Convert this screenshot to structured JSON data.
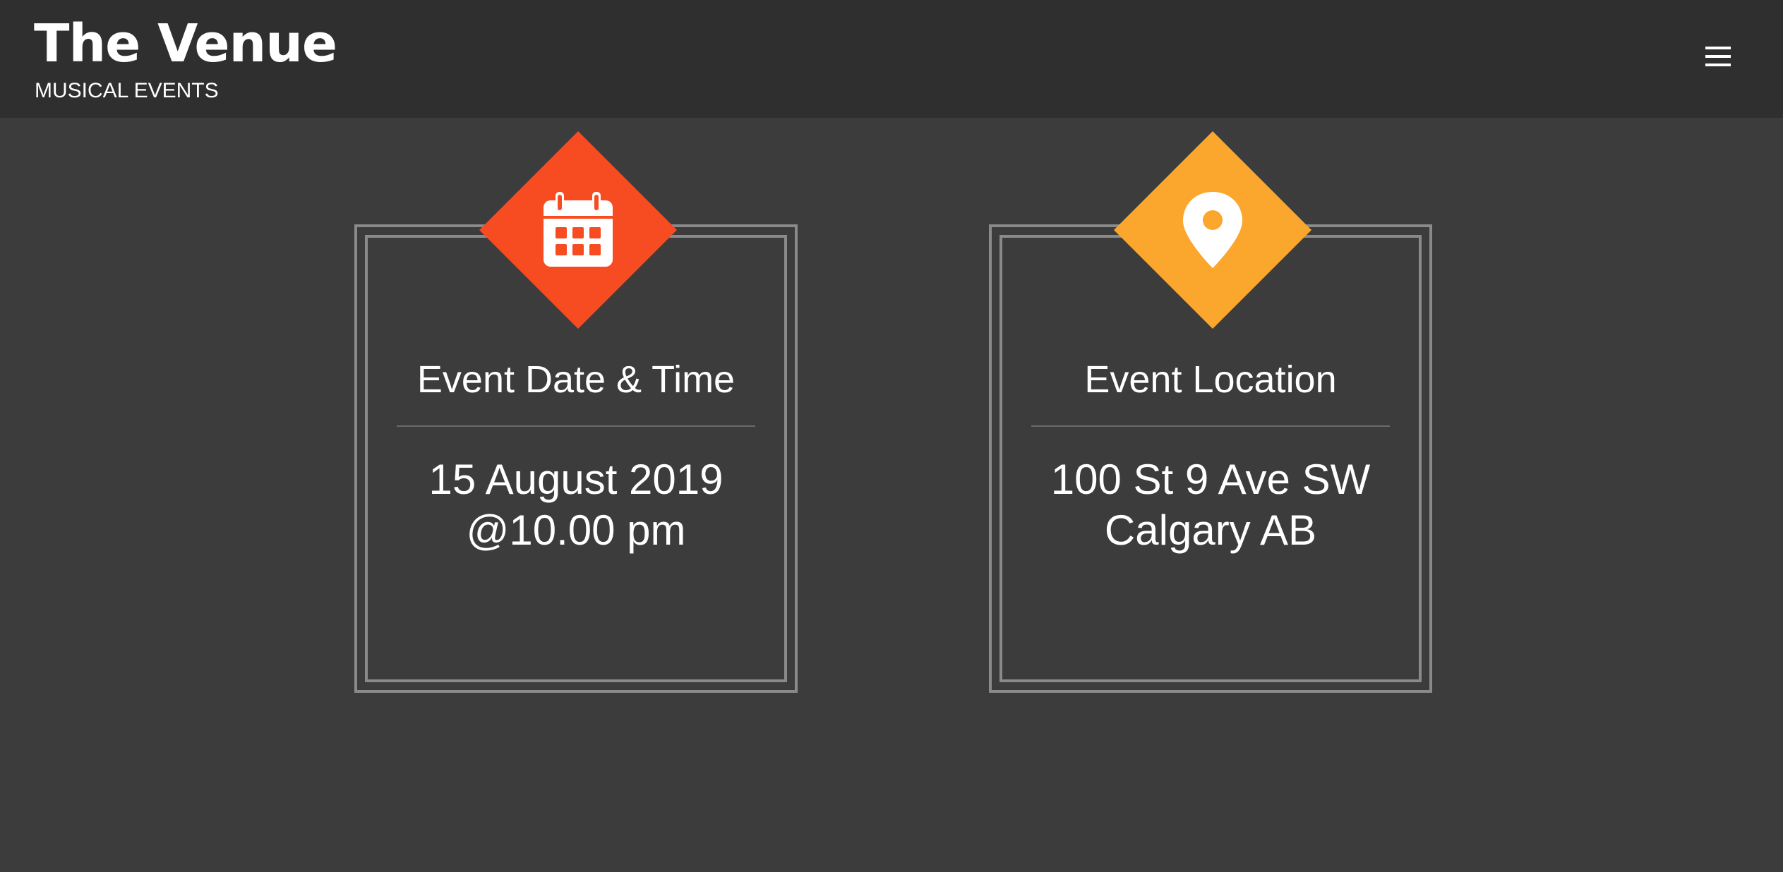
{
  "header": {
    "title": "The Venue",
    "subtitle": "MUSICAL EVENTS",
    "menu_icon": "hamburger-menu-icon"
  },
  "cards": [
    {
      "icon": "calendar-icon",
      "accent": "#f74b21",
      "heading": "Event Date & Time",
      "lines": [
        "15 August 2019",
        "@10.00 pm"
      ]
    },
    {
      "icon": "map-pin-icon",
      "accent": "#fba62d",
      "heading": "Event Location",
      "lines": [
        "100 St 9 Ave SW",
        "Calgary AB"
      ]
    }
  ],
  "colors": {
    "background": "#3c3c3c",
    "header": "#2f2f2f",
    "border": "#8a8a8a"
  }
}
